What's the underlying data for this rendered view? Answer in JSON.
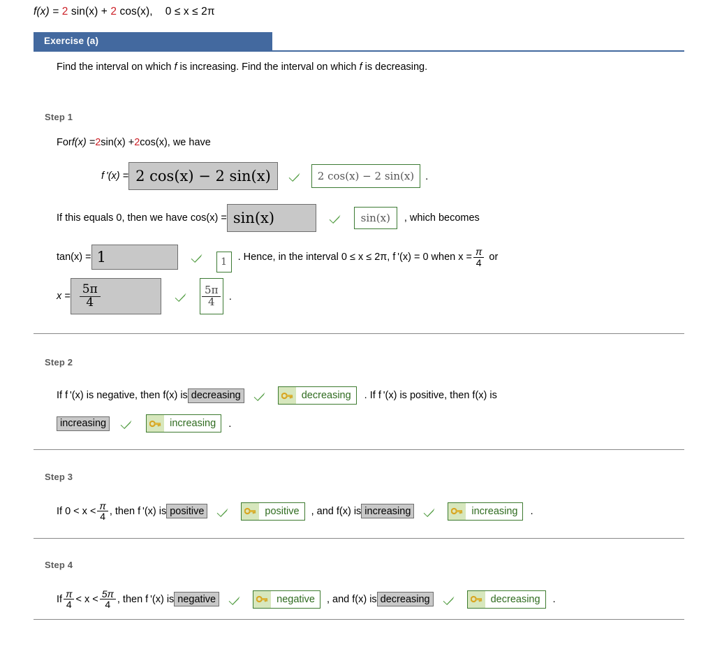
{
  "problem": {
    "prefix": "f(x) = ",
    "coef1": "2",
    "term1": " sin(x) + ",
    "coef2": "2",
    "term2": " cos(x),",
    "domain": "0 ≤ x ≤ 2π"
  },
  "exercise": {
    "tab_label": "Exercise (a)",
    "prompt": "Find the interval on which f is increasing. Find the interval on which f is decreasing."
  },
  "colors": {
    "header_blue": "#43699f",
    "answer_gray": "#c8c8c8",
    "answer_gray_border": "#6e6e6e",
    "correct_green": "#4f9b3f",
    "key_border_green": "#3d7a2f",
    "key_bg_green": "#d7e7bd",
    "key_text_green": "#2f6b1f",
    "divider_gray": "#888888",
    "red_coefficient": "#cc2027",
    "step_label_gray": "#5b5b5b"
  },
  "steps": [
    {
      "label": "Step 1",
      "line1": {
        "pre": "For ",
        "fx": "f(x) = ",
        "coef1": "2",
        "mid": " sin(x) + ",
        "coef2": "2",
        "post": " cos(x),  we have"
      },
      "line2": {
        "lhs": "f '(x) = ",
        "student_answer": "2 cos(x) − 2 sin(x)",
        "correct_answer": "2 cos(x) − 2 sin(x)",
        "trailing": "."
      },
      "line3": {
        "pre": "If this equals 0, then we have  cos(x) = ",
        "student_answer": "sin(x)",
        "correct_answer": "sin(x)",
        "post": ",  which becomes"
      },
      "line4": {
        "pre": "tan(x) = ",
        "student_answer": "1",
        "correct_answer": "1",
        "post": ".  Hence, in the interval 0 ≤ x ≤ 2π,  f '(x) = 0  when  x = ",
        "frac_num": "π",
        "frac_den": "4",
        "tail": " or"
      },
      "line5": {
        "pre": "x = ",
        "student_num": "5π",
        "student_den": "4",
        "correct_num": "5π",
        "correct_den": "4",
        "trailing": "."
      }
    },
    {
      "label": "Step 2",
      "line1": {
        "pre": "If  f '(x)  is negative, then  f(x)  is ",
        "student_answer": "decreasing",
        "correct_answer": "decreasing",
        "post": ". If  f '(x)  is positive, then  f(x)  is"
      },
      "line2": {
        "student_answer": "increasing",
        "correct_answer": "increasing",
        "trailing": "."
      }
    },
    {
      "label": "Step 3",
      "line1": {
        "pre": "If  0 < x < ",
        "frac_num": "π",
        "frac_den": "4",
        "mid1": ",  then  f '(x)  is ",
        "student_answer1": "positive",
        "correct_answer1": "positive",
        "mid2": ",  and  f(x)  is ",
        "student_answer2": "increasing",
        "correct_answer2": "increasing",
        "trailing": "."
      }
    },
    {
      "label": "Step 4",
      "line1": {
        "pre": "If ",
        "frac1_num": "π",
        "frac1_den": "4",
        "mid0": " < x < ",
        "frac2_num": "5π",
        "frac2_den": "4",
        "mid1": ",  then  f '(x)  is ",
        "student_answer1": "negative",
        "correct_answer1": "negative",
        "mid2": ",  and  f(x)  is ",
        "student_answer2": "decreasing",
        "correct_answer2": "decreasing",
        "trailing": "."
      }
    }
  ],
  "icons": {
    "check": "check-mark-icon",
    "key": "key-icon"
  }
}
